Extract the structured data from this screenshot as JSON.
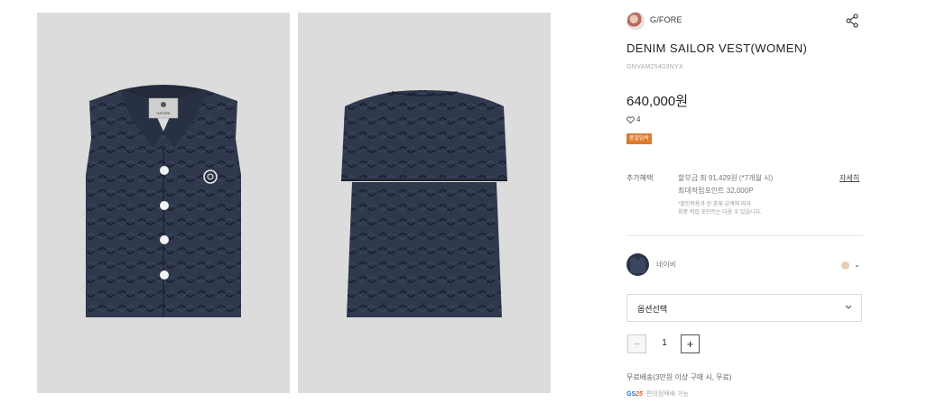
{
  "brand": {
    "name": "G/FORE",
    "tag_label": "G/FORE"
  },
  "product": {
    "title": "DENIM SAILOR VEST(WOMEN)",
    "code": "GNVAM25403NYX",
    "price": "640,000원",
    "likes": "4",
    "badge": "품절임박"
  },
  "benefits": {
    "label": "추가혜택",
    "line1": "할부금 최 91,429원 (*7개월 시)",
    "line2": "최대적립포인트 32,000P",
    "note1": "*할인적용과 쉰 혼재 금액에 따라",
    "note2": "최종 적립 포인트는 다음 수 있습니다.",
    "detail_link": "자세히"
  },
  "color": {
    "name": "네이비",
    "swatch": "#2b3346",
    "alt_dot": "#e7cfb6"
  },
  "option": {
    "label": "옵션선택"
  },
  "quantity": {
    "minus": "−",
    "value": "1",
    "plus": "+"
  },
  "shipping": {
    "text": "무료배송(3만원 이상 구매 시, 무료)"
  },
  "store": {
    "logo_main": "GS",
    "logo_accent": "25",
    "text": "편의점택배 가능"
  },
  "colors": {
    "accent_badge": "#e07a2a",
    "vest_navy": "#2b3346",
    "bg_image": "#dcdcdc"
  }
}
